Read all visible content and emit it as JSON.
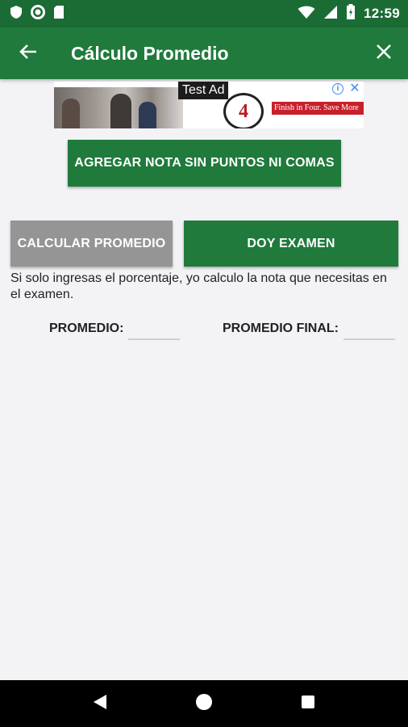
{
  "status_bar": {
    "time": "12:59",
    "icons": [
      "shield-icon",
      "circle-status-icon",
      "sd-card-icon",
      "wifi-icon",
      "cell-signal-icon",
      "battery-icon"
    ]
  },
  "app_bar": {
    "title": "Cálculo Promedio",
    "back_icon": "arrow-back-icon",
    "close_icon": "close-icon",
    "color": "#1f7a3c"
  },
  "ad": {
    "tag": "Test Ad",
    "logo_text": "4",
    "banner_text": "Finish in Four. Save More"
  },
  "buttons": {
    "agregar": "AGREGAR NOTA SIN PUNTOS NI COMAS",
    "calcular": "CALCULAR PROMEDIO",
    "examen": "DOY EXAMEN"
  },
  "info_text": "Si solo ingresas el porcentaje, yo calculo la nota que necesitas en el examen.",
  "labels": {
    "promedio": "PROMEDIO:",
    "promedio_final": "PROMEDIO FINAL:"
  },
  "fields": {
    "promedio": "",
    "promedio_final": ""
  },
  "colors": {
    "primary": "#1f7a3c",
    "status_bar": "#1b6b35",
    "disabled_button": "#959595"
  }
}
